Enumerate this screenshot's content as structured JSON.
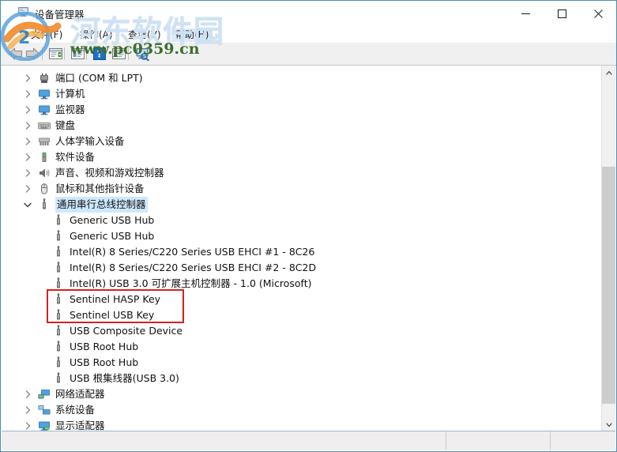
{
  "window": {
    "title": "设备管理器",
    "icon": "device-manager-icon",
    "controls": {
      "minimize": "–",
      "maximize": "□",
      "close": "✕"
    }
  },
  "menu": {
    "items": [
      {
        "label": "文件(F)",
        "highlighted": false
      },
      {
        "label": "操作(A)",
        "highlighted": false
      },
      {
        "label": "查看(V)",
        "highlighted": false
      },
      {
        "label": "帮助(H)",
        "highlighted": true
      }
    ]
  },
  "toolbar": {
    "buttons": [
      {
        "name": "back-button",
        "icon": "back-arrow-icon"
      },
      {
        "name": "forward-button",
        "icon": "forward-arrow-icon"
      },
      {
        "name": "properties-button",
        "icon": "properties-icon"
      },
      {
        "name": "update-driver-button",
        "icon": "update-driver-icon"
      },
      {
        "name": "help-button",
        "icon": "help-question-icon"
      },
      {
        "name": "scan-button",
        "icon": "scan-devices-icon"
      },
      {
        "name": "search-hardware-changes-button",
        "icon": "monitor-search-icon"
      }
    ]
  },
  "tree": {
    "nodes": [
      {
        "label": "端口 (COM 和 LPT)",
        "level": 1,
        "expander": "collapsed",
        "icon": "port-icon",
        "selected": false
      },
      {
        "label": "计算机",
        "level": 1,
        "expander": "collapsed",
        "icon": "computer-icon",
        "selected": false
      },
      {
        "label": "监视器",
        "level": 1,
        "expander": "collapsed",
        "icon": "monitor-icon",
        "selected": false
      },
      {
        "label": "键盘",
        "level": 1,
        "expander": "collapsed",
        "icon": "keyboard-icon",
        "selected": false
      },
      {
        "label": "人体学输入设备",
        "level": 1,
        "expander": "collapsed",
        "icon": "hid-icon",
        "selected": false
      },
      {
        "label": "软件设备",
        "level": 1,
        "expander": "collapsed",
        "icon": "software-device-icon",
        "selected": false
      },
      {
        "label": "声音、视频和游戏控制器",
        "level": 1,
        "expander": "collapsed",
        "icon": "sound-icon",
        "selected": false
      },
      {
        "label": "鼠标和其他指针设备",
        "level": 1,
        "expander": "collapsed",
        "icon": "mouse-icon",
        "selected": false
      },
      {
        "label": "通用串行总线控制器",
        "level": 1,
        "expander": "expanded",
        "icon": "usb-icon",
        "selected": true
      },
      {
        "label": "Generic USB Hub",
        "level": 2,
        "expander": "none",
        "icon": "usb-icon",
        "selected": false
      },
      {
        "label": "Generic USB Hub",
        "level": 2,
        "expander": "none",
        "icon": "usb-icon",
        "selected": false
      },
      {
        "label": "Intel(R) 8 Series/C220 Series USB EHCI #1 - 8C26",
        "level": 2,
        "expander": "none",
        "icon": "usb-icon",
        "selected": false
      },
      {
        "label": "Intel(R) 8 Series/C220 Series USB EHCI #2 - 8C2D",
        "level": 2,
        "expander": "none",
        "icon": "usb-icon",
        "selected": false
      },
      {
        "label": "Intel(R) USB 3.0 可扩展主机控制器 - 1.0 (Microsoft)",
        "level": 2,
        "expander": "none",
        "icon": "usb-icon",
        "selected": false
      },
      {
        "label": "Sentinel HASP Key",
        "level": 2,
        "expander": "none",
        "icon": "usb-icon",
        "selected": false
      },
      {
        "label": "Sentinel USB Key",
        "level": 2,
        "expander": "none",
        "icon": "usb-icon",
        "selected": false
      },
      {
        "label": "USB Composite Device",
        "level": 2,
        "expander": "none",
        "icon": "usb-icon",
        "selected": false
      },
      {
        "label": "USB Root Hub",
        "level": 2,
        "expander": "none",
        "icon": "usb-icon",
        "selected": false
      },
      {
        "label": "USB Root Hub",
        "level": 2,
        "expander": "none",
        "icon": "usb-icon",
        "selected": false
      },
      {
        "label": "USB 根集线器(USB 3.0)",
        "level": 2,
        "expander": "none",
        "icon": "usb-icon",
        "selected": false
      },
      {
        "label": "网络适配器",
        "level": 1,
        "expander": "collapsed",
        "icon": "network-adapter-icon",
        "selected": false
      },
      {
        "label": "系统设备",
        "level": 1,
        "expander": "collapsed",
        "icon": "system-device-icon",
        "selected": false
      },
      {
        "label": "显示适配器",
        "level": 1,
        "expander": "collapsed",
        "icon": "display-adapter-icon",
        "selected": false
      }
    ]
  },
  "annotation": {
    "highlight_box": {
      "color": "#d81f1f",
      "covers": [
        "Sentinel HASP Key",
        "Sentinel USB Key"
      ]
    }
  },
  "scrollbar": {
    "up_arrow": "▲",
    "down_arrow": "▼"
  },
  "statusbar": {
    "panes": [
      "",
      "",
      ""
    ]
  },
  "watermark": {
    "chinese": "河东软件园",
    "url": "www.pc0359.cn"
  },
  "colors": {
    "selection": "#cde8ff",
    "highlight_box": "#d81f1f",
    "window_border": "#4a8dbb",
    "toolbar_bg": "#f0f0f0",
    "statusbar_bg": "#f0eeee"
  }
}
